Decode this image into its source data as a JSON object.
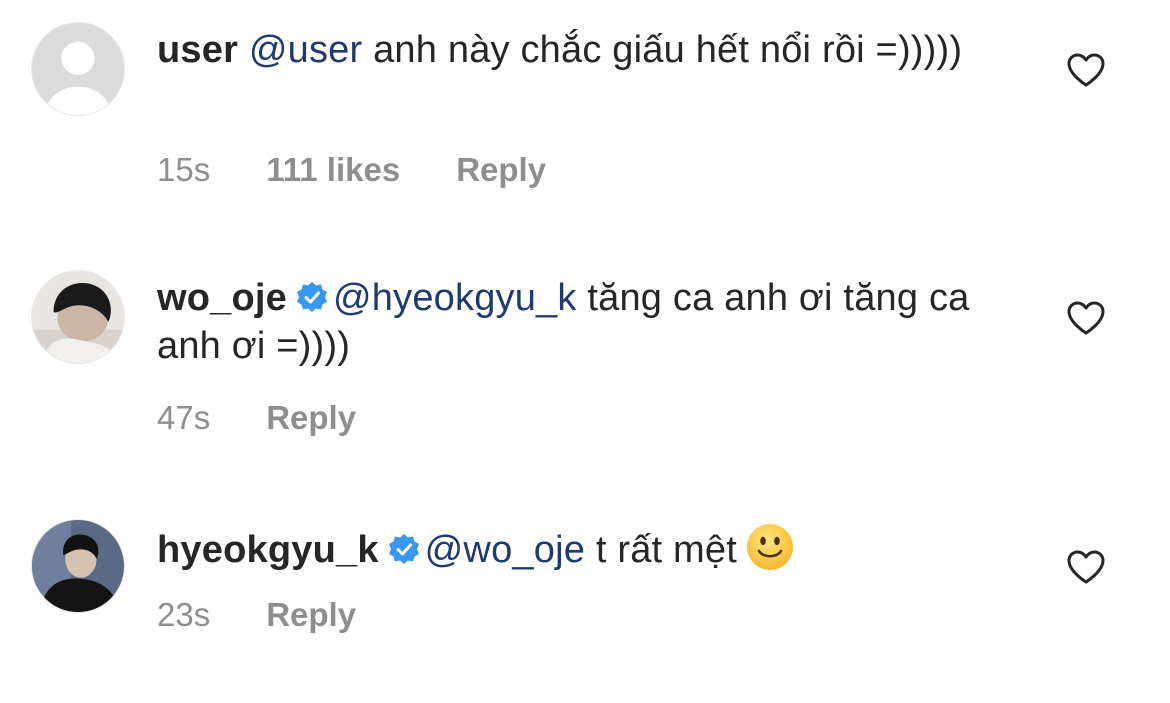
{
  "comments": [
    {
      "username": "user",
      "verified": false,
      "mention": "@user",
      "text": " anh này chắc giấu hết nổi rồi =)))))",
      "time": "15s",
      "likes": "111 likes",
      "reply": "Reply"
    },
    {
      "username": "wo_oje",
      "verified": true,
      "mention": "@hyeokgyu_k",
      "text": " tăng ca anh ơi tăng ca anh ơi =))))",
      "time": "47s",
      "reply": "Reply"
    },
    {
      "username": "hyeokgyu_k",
      "verified": true,
      "mention": "@wo_oje",
      "text": " t rất mệt",
      "emoji": "slightly-smiling-face-emoji",
      "time": "23s",
      "reply": "Reply"
    }
  ],
  "icons": {
    "like": "heart-outline-icon",
    "verified": "verified-badge-icon"
  },
  "colors": {
    "text": "#262626",
    "mention": "#1f3a6e",
    "meta": "#8e8e8e",
    "verified": "#3897f0"
  }
}
